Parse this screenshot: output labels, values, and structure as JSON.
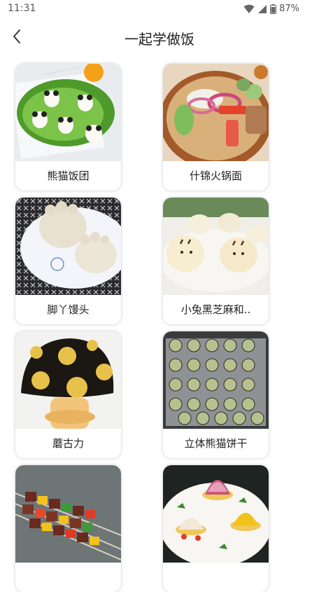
{
  "status": {
    "time": "11:31",
    "battery": "87%",
    "icons": [
      "wifi-icon",
      "signal-icon",
      "battery-icon"
    ]
  },
  "header": {
    "title": "一起学做饭",
    "back_icon": "chevron-left-icon"
  },
  "recipes": [
    {
      "label": "熊猫饭团"
    },
    {
      "label": "什锦火锅面"
    },
    {
      "label": "脚丫馒头"
    },
    {
      "label": "小兔黑芝麻和.."
    },
    {
      "label": "蘑古力"
    },
    {
      "label": "立体熊猫饼干"
    },
    {
      "label": ""
    },
    {
      "label": ""
    }
  ]
}
